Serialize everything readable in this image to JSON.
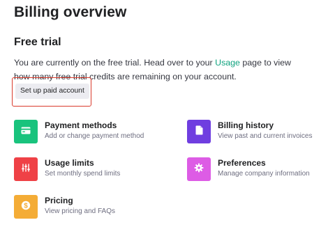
{
  "page": {
    "title": "Billing overview"
  },
  "free_trial": {
    "heading": "Free trial",
    "text_before": "You are currently on the free trial. Head over to your ",
    "link": "Usage",
    "text_after": " page to view how many free trial credits are remaining on your account.",
    "button_label": "Set up paid account"
  },
  "cards": [
    {
      "title": "Payment methods",
      "subtitle": "Add or change payment method",
      "icon": "credit-card-icon",
      "color": "#19c37d"
    },
    {
      "title": "Billing history",
      "subtitle": "View past and current invoices",
      "icon": "document-icon",
      "color": "#6f3ee0"
    },
    {
      "title": "Usage limits",
      "subtitle": "Set monthly spend limits",
      "icon": "sliders-icon",
      "color": "#ef4146"
    },
    {
      "title": "Preferences",
      "subtitle": "Manage company information",
      "icon": "gear-icon",
      "color": "#dd5ce5"
    },
    {
      "title": "Pricing",
      "subtitle": "View pricing and FAQs",
      "icon": "dollar-icon",
      "color": "#f4ac36"
    }
  ]
}
